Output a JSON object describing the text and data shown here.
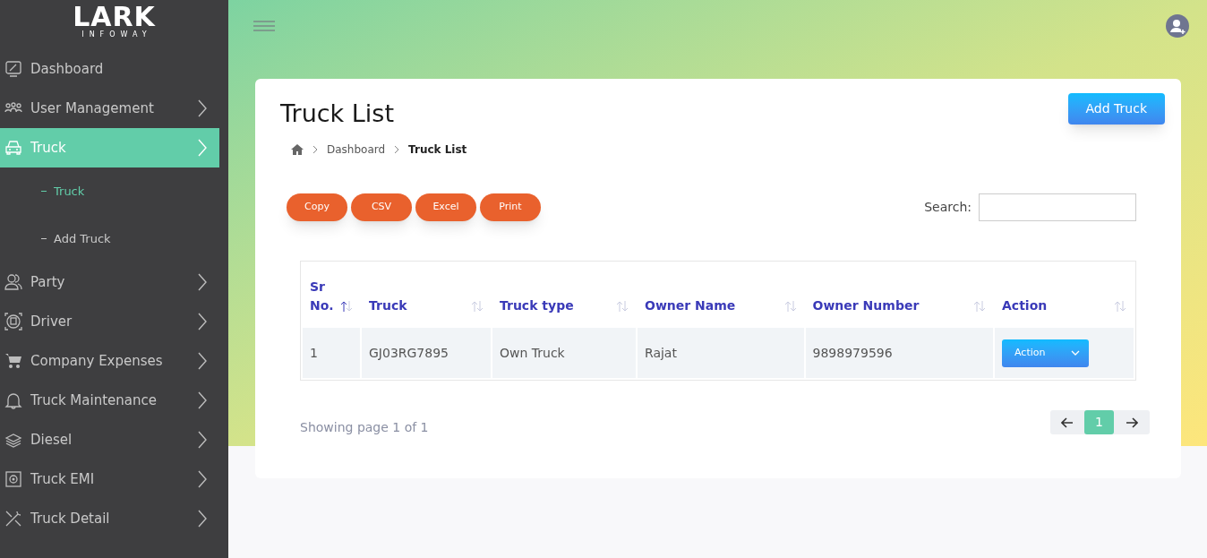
{
  "logo": {
    "name": "LARK",
    "tagline": "INFOWAY"
  },
  "sidebar": {
    "items": [
      {
        "label": "Dashboard",
        "kind": "link",
        "selected": false
      },
      {
        "label": "User Management",
        "kind": "menu",
        "selected": false
      },
      {
        "label": "Truck",
        "kind": "menu",
        "selected": true,
        "children": [
          {
            "label": "Truck",
            "selected": true
          },
          {
            "label": "Add Truck",
            "selected": false
          }
        ]
      },
      {
        "label": "Party",
        "kind": "menu",
        "selected": false
      },
      {
        "label": "Driver",
        "kind": "menu",
        "selected": false
      },
      {
        "label": "Company Expenses",
        "kind": "menu",
        "selected": false
      },
      {
        "label": "Truck Maintenance",
        "kind": "menu",
        "selected": false
      },
      {
        "label": "Diesel",
        "kind": "menu",
        "selected": false
      },
      {
        "label": "Truck EMI",
        "kind": "menu",
        "selected": false
      },
      {
        "label": "Truck Detail",
        "kind": "menu",
        "selected": false
      }
    ]
  },
  "page": {
    "title": "Truck List",
    "add_button": "Add Truck",
    "breadcrumb": [
      {
        "label": "Dashboard",
        "current": false
      },
      {
        "label": "Truck List",
        "current": true
      }
    ],
    "export_buttons": [
      "Copy",
      "CSV",
      "Excel",
      "Print"
    ],
    "search": {
      "label": "Search:"
    },
    "table": {
      "columns": [
        {
          "label": "Sr No.",
          "sorted": true
        },
        {
          "label": "Truck",
          "sorted": false
        },
        {
          "label": "Truck type",
          "sorted": false
        },
        {
          "label": "Owner Name",
          "sorted": false
        },
        {
          "label": "Owner Number",
          "sorted": false
        },
        {
          "label": "Action",
          "sorted": false
        }
      ],
      "rows": [
        {
          "cells": [
            "1",
            "GJ03RG7895",
            "Own Truck",
            "Rajat",
            "9898979596"
          ],
          "action": "Action"
        }
      ]
    },
    "info": "Showing page 1 of 1",
    "pagination": [
      {
        "label": "1",
        "selected": true
      }
    ]
  }
}
